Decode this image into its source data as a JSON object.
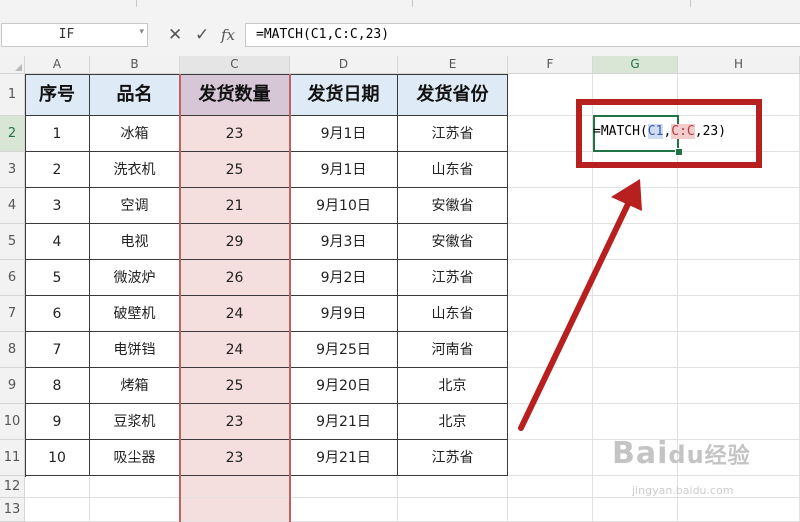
{
  "formula_bar": {
    "name_box": "IF",
    "cancel_icon": "cancel-icon",
    "enter_icon": "check-icon",
    "fx_label": "fx",
    "formula": "=MATCH(C1,C:C,23)"
  },
  "columns": [
    "A",
    "B",
    "C",
    "D",
    "E",
    "F",
    "G",
    "H"
  ],
  "rows": [
    "1",
    "2",
    "3",
    "4",
    "5",
    "6",
    "7",
    "8",
    "9",
    "10",
    "11",
    "12",
    "13"
  ],
  "table": {
    "headers": [
      "序号",
      "品名",
      "发货数量",
      "发货日期",
      "发货省份"
    ],
    "data": [
      [
        "1",
        "冰箱",
        "23",
        "9月1日",
        "江苏省"
      ],
      [
        "2",
        "洗衣机",
        "25",
        "9月1日",
        "山东省"
      ],
      [
        "3",
        "空调",
        "21",
        "9月10日",
        "安徽省"
      ],
      [
        "4",
        "电视",
        "29",
        "9月3日",
        "安徽省"
      ],
      [
        "5",
        "微波炉",
        "26",
        "9月2日",
        "江苏省"
      ],
      [
        "6",
        "破壁机",
        "24",
        "9月9日",
        "山东省"
      ],
      [
        "7",
        "电饼铛",
        "24",
        "9月25日",
        "河南省"
      ],
      [
        "8",
        "烤箱",
        "25",
        "9月20日",
        "北京"
      ],
      [
        "9",
        "豆浆机",
        "23",
        "9月21日",
        "北京"
      ],
      [
        "10",
        "吸尘器",
        "23",
        "9月21日",
        "江苏省"
      ]
    ]
  },
  "active_cell": {
    "editor": {
      "pre": "=MATCH(",
      "ref1": "C1",
      "sep": ",",
      "ref2": "C:C",
      "post": ",23)"
    }
  },
  "watermark": {
    "brand": "Bai",
    "paw": "du",
    "cn": "经验",
    "url": "jingyan.baidu.com"
  },
  "colors": {
    "annotation_red": "#b81f1f",
    "header_fill": "#deebf6",
    "column_c_fill": "#f5dede",
    "active_green": "#217346"
  }
}
